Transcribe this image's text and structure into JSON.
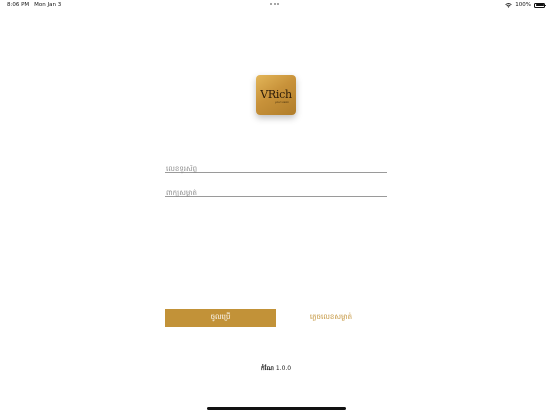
{
  "status_bar": {
    "time": "8:06 PM",
    "date": "Mon Jan 3",
    "battery_text": "100%",
    "battery_level": 1.0,
    "wifi_icon": "wifi-icon",
    "battery_icon": "battery-icon"
  },
  "logo": {
    "brand": "VRich",
    "tagline": "your vision"
  },
  "login_form": {
    "username_placeholder": "លេខទូរស័ព្ទ",
    "password_placeholder": "ពាក្យសម្ងាត់",
    "login_button_label": "ចូលប្រើ",
    "forgot_password_label": "ភ្លេចលេខសម្ងាត់"
  },
  "footer": {
    "version_label": "កំណែ",
    "version_number": "1.0.0"
  },
  "colors": {
    "accent": "#c29238",
    "background": "#ffffff"
  }
}
